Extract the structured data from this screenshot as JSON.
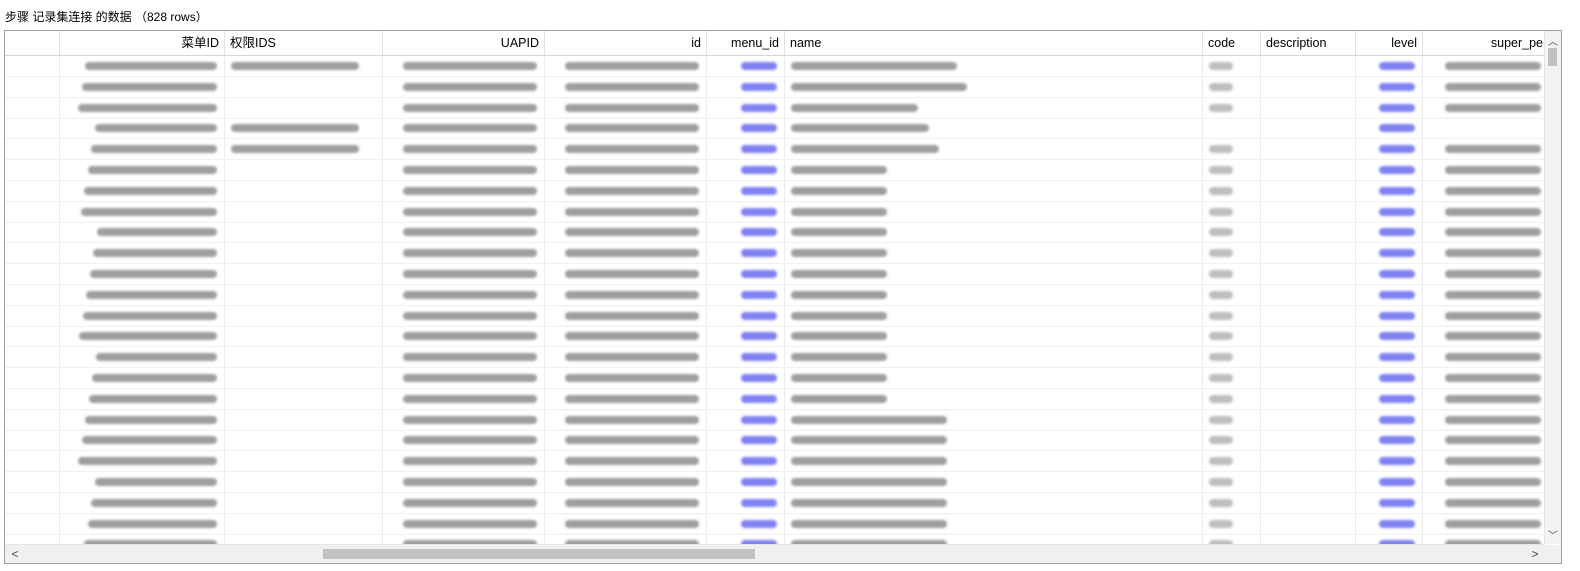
{
  "title": "步骤 记录集连接 的数据 （828 rows）",
  "columns": [
    {
      "key": "rownum",
      "label": "",
      "w": 55,
      "align": "l"
    },
    {
      "key": "menu_id_cn",
      "label": "菜单ID",
      "w": 165,
      "align": "r"
    },
    {
      "key": "perm_ids",
      "label": "权限IDS",
      "w": 158,
      "align": "l"
    },
    {
      "key": "uapid",
      "label": "UAPID",
      "w": 162,
      "align": "r"
    },
    {
      "key": "id",
      "label": "id",
      "w": 162,
      "align": "r"
    },
    {
      "key": "menu_id",
      "label": "menu_id",
      "w": 78,
      "align": "r"
    },
    {
      "key": "name",
      "label": "name",
      "w": 418,
      "align": "l"
    },
    {
      "key": "code",
      "label": "code",
      "w": 58,
      "align": "l"
    },
    {
      "key": "description",
      "label": "description",
      "w": 95,
      "align": "l"
    },
    {
      "key": "level",
      "label": "level",
      "w": 67,
      "align": "r"
    },
    {
      "key": "super_pe",
      "label": "super_pe",
      "w": 126,
      "align": "r"
    }
  ],
  "row_count_visible": 24,
  "scroll": {
    "left_arrow": "<",
    "right_arrow": ">",
    "up_arrow": "^",
    "down_arrow": "v"
  },
  "colors": {
    "link": "#6a6cf0",
    "text": "#8e8e8e",
    "border": "#a0a0a0"
  }
}
